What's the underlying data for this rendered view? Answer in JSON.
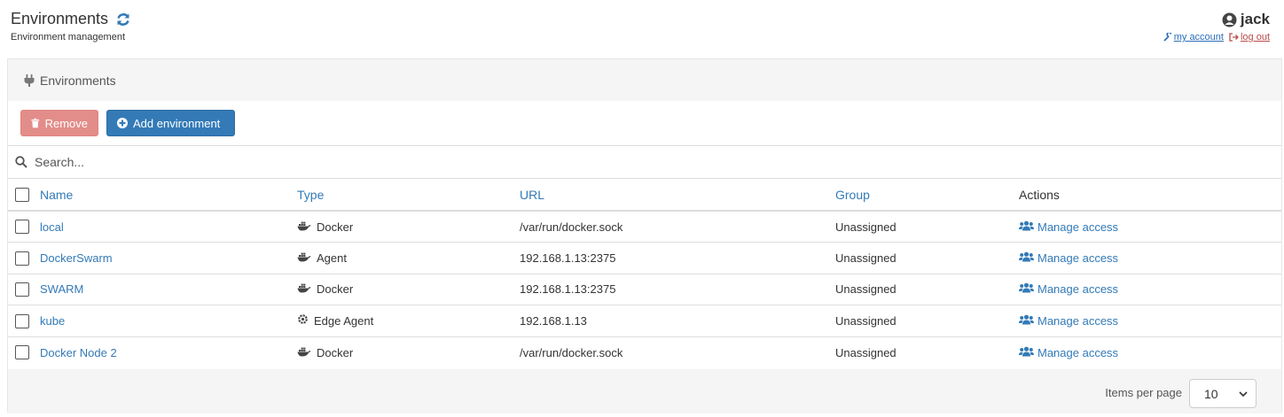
{
  "header": {
    "title": "Environments",
    "subtitle": "Environment management",
    "username": "jack",
    "my_account": "my account",
    "log_out": "log out"
  },
  "widget": {
    "title": "Environments",
    "remove_label": "Remove",
    "add_label": "Add environment",
    "search_placeholder": "Search...",
    "columns": {
      "name": "Name",
      "type": "Type",
      "url": "URL",
      "group": "Group",
      "actions": "Actions"
    },
    "rows": [
      {
        "name": "local",
        "type": "Docker",
        "type_icon": "docker-icon",
        "url": "/var/run/docker.sock",
        "group": "Unassigned",
        "action": "Manage access"
      },
      {
        "name": "DockerSwarm",
        "type": "Agent",
        "type_icon": "docker-icon",
        "url": "192.168.1.13:2375",
        "group": "Unassigned",
        "action": "Manage access"
      },
      {
        "name": "SWARM",
        "type": "Docker",
        "type_icon": "docker-icon",
        "url": "192.168.1.13:2375",
        "group": "Unassigned",
        "action": "Manage access"
      },
      {
        "name": "kube",
        "type": "Edge Agent",
        "type_icon": "cloud-gear-icon",
        "url": "192.168.1.13",
        "group": "Unassigned",
        "action": "Manage access"
      },
      {
        "name": "Docker Node 2",
        "type": "Docker",
        "type_icon": "docker-icon",
        "url": "/var/run/docker.sock",
        "group": "Unassigned",
        "action": "Manage access"
      }
    ],
    "items_per_page_label": "Items per page",
    "items_per_page_value": "10"
  },
  "colors": {
    "link": "#337ab7",
    "remove": "#e38d8a",
    "add": "#337ab7",
    "logout": "#b94a48"
  }
}
